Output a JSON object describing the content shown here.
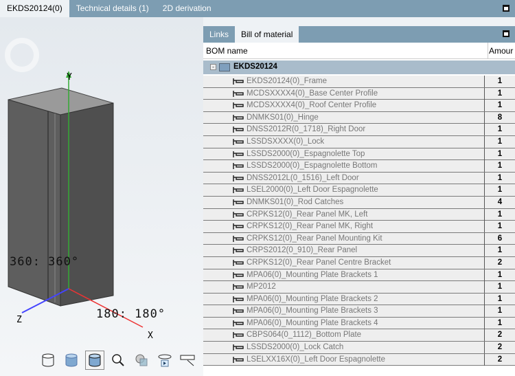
{
  "top_tabs": [
    "EKDS20124(0)",
    "Technical details (1)",
    "2D derivation"
  ],
  "viewer": {
    "axis_labels": {
      "y": "Y",
      "z": "Z",
      "x": "X"
    },
    "angle_left": "360: 360°",
    "angle_right": "180: 180°",
    "toolbar": [
      "wireframe-icon",
      "shaded-icon",
      "shaded-edges-icon",
      "zoom-fit-icon",
      "transparency-icon",
      "rotate-icon",
      "measure-icon",
      "more-dropdown-icon"
    ]
  },
  "panel": {
    "tabs": [
      "Links",
      "Bill of material"
    ],
    "columns": [
      "BOM name",
      "Amour"
    ],
    "root": "EKDS20124",
    "items": [
      {
        "name": "EKDS20124(0)_Frame",
        "amount": "1"
      },
      {
        "name": "MCDSXXXX4(0)_Base Center Profile",
        "amount": "1"
      },
      {
        "name": "MCDSXXXX4(0)_Roof Center Profile",
        "amount": "1"
      },
      {
        "name": "DNMKS01(0)_Hinge",
        "amount": "8"
      },
      {
        "name": "DNSS2012R(0_1718)_Right Door",
        "amount": "1"
      },
      {
        "name": "LSSDSXXXX(0)_Lock",
        "amount": "1"
      },
      {
        "name": "LSSDS2000(0)_Espagnolette Top",
        "amount": "1"
      },
      {
        "name": "LSSDS2000(0)_Espagnolette Bottom",
        "amount": "1"
      },
      {
        "name": "DNSS2012L(0_1516)_Left Door",
        "amount": "1"
      },
      {
        "name": "LSEL2000(0)_Left Door Espagnolette",
        "amount": "1"
      },
      {
        "name": "DNMKS01(0)_Rod Catches",
        "amount": "4"
      },
      {
        "name": "CRPKS12(0)_Rear Panel MK, Left",
        "amount": "1"
      },
      {
        "name": "CRPKS12(0)_Rear Panel MK, Right",
        "amount": "1"
      },
      {
        "name": "CRPKS12(0)_Rear Panel Mounting Kit",
        "amount": "6"
      },
      {
        "name": "CRPS2012(0_910)_Rear Panel",
        "amount": "1"
      },
      {
        "name": "CRPKS12(0)_Rear Panel Centre Bracket",
        "amount": "2"
      },
      {
        "name": "MPA06(0)_Mounting Plate Brackets 1",
        "amount": "1"
      },
      {
        "name": "MP2012",
        "amount": "1"
      },
      {
        "name": "MPA06(0)_Mounting Plate Brackets 2",
        "amount": "1"
      },
      {
        "name": "MPA06(0)_Mounting Plate Brackets 3",
        "amount": "1"
      },
      {
        "name": "MPA06(0)_Mounting Plate Brackets 4",
        "amount": "1"
      },
      {
        "name": "CBPS064(0_1112)_Bottom Plate",
        "amount": "2"
      },
      {
        "name": "LSSDS2000(0)_Lock Catch",
        "amount": "2"
      },
      {
        "name": "LSELXX16X(0)_Left Door Espagnolette",
        "amount": "2"
      }
    ]
  }
}
